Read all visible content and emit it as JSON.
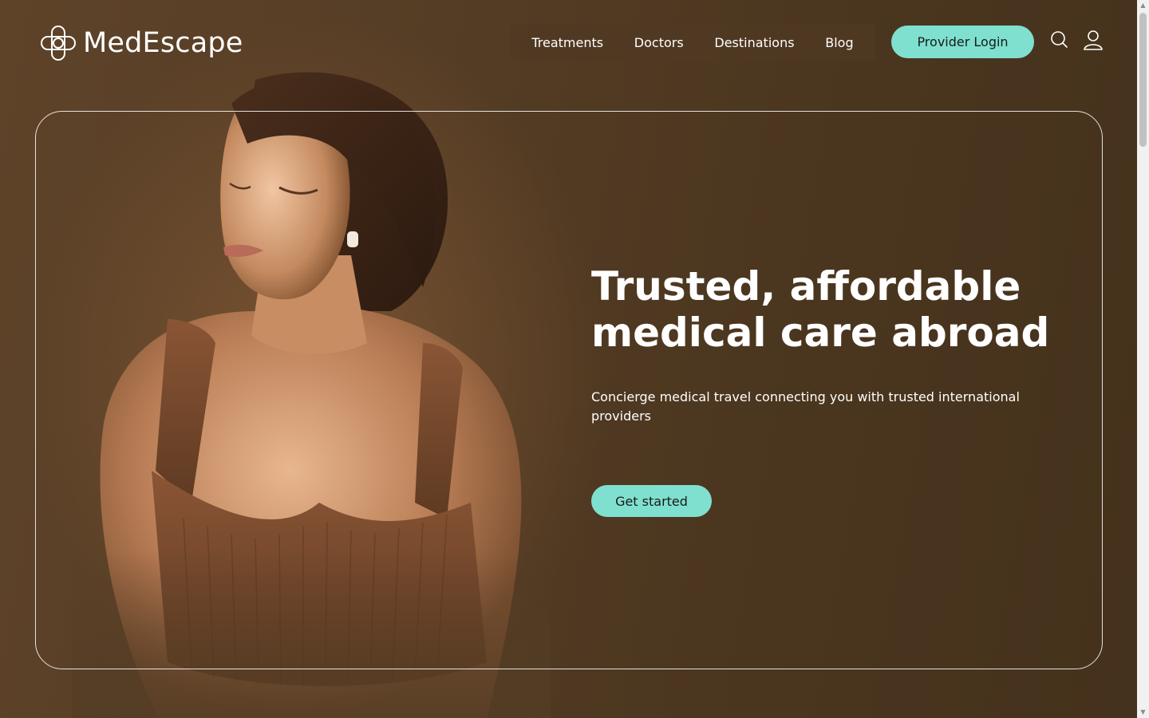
{
  "brand": {
    "name": "MedEscape",
    "logo_icon": "medical-cross-logo-icon"
  },
  "nav": {
    "items": [
      {
        "label": "Treatments"
      },
      {
        "label": "Doctors"
      },
      {
        "label": "Destinations"
      },
      {
        "label": "Blog"
      }
    ],
    "provider_login": "Provider Login",
    "search_icon": "search-icon",
    "user_icon": "user-icon"
  },
  "hero": {
    "title_line1": "Trusted, affordable",
    "title_line2": "medical care abroad",
    "subtitle": "Concierge medical travel connecting you with trusted international providers",
    "cta": "Get started",
    "image_alt": "Woman with eyes closed in warm sunlight"
  },
  "colors": {
    "accent": "#7fe0cf",
    "background": "#4b361f",
    "text": "#ffffff"
  }
}
